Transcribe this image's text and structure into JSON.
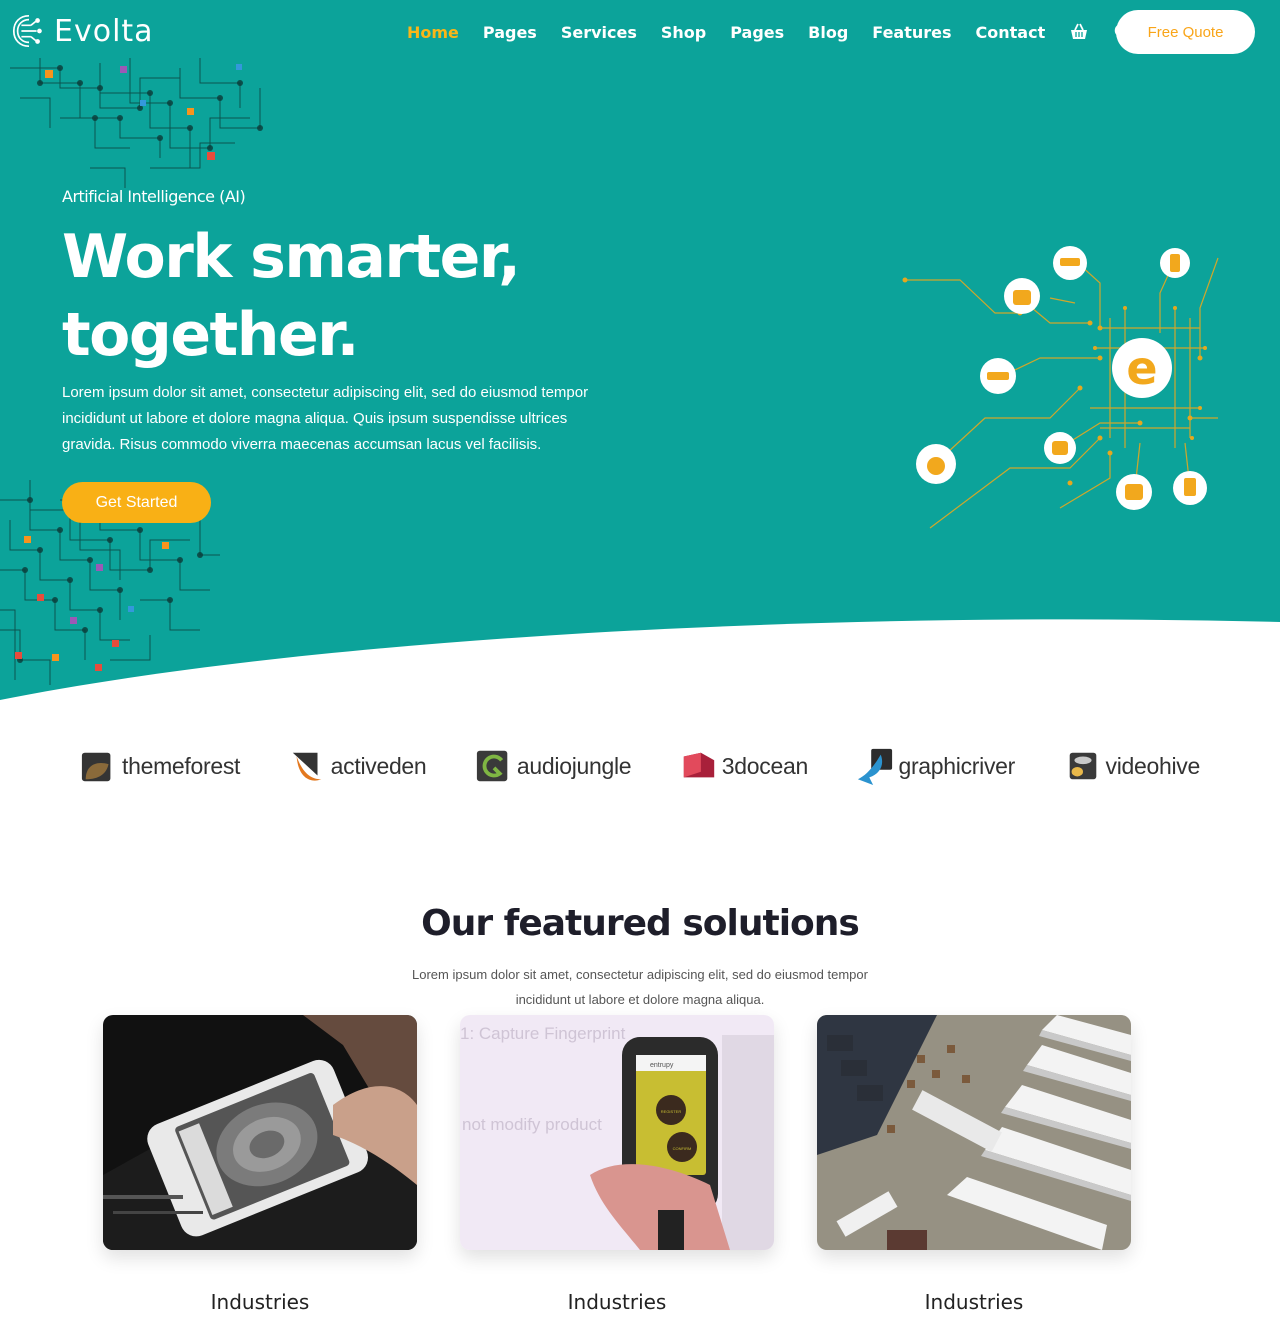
{
  "header": {
    "logo_text": "Evolta",
    "nav": [
      {
        "label": "Home",
        "active": true
      },
      {
        "label": "Pages",
        "active": false
      },
      {
        "label": "Services",
        "active": false
      },
      {
        "label": "Shop",
        "active": false
      },
      {
        "label": "Pages",
        "active": false
      },
      {
        "label": "Blog",
        "active": false
      },
      {
        "label": "Features",
        "active": false
      },
      {
        "label": "Contact",
        "active": false
      }
    ],
    "icons": [
      "basket-icon",
      "search-icon"
    ],
    "quote_label": "Free Quote"
  },
  "hero": {
    "eyebrow": "Artificial Intelligence (AI)",
    "headline_line1": "Work smarter,",
    "headline_line2": "together.",
    "description": "Lorem ipsum dolor sit amet, consectetur adipiscing elit, sed do eiusmod tempor incididunt ut labore et dolore magna aliqua. Quis ipsum suspendisse ultrices gravida. Risus commodo viverra maecenas accumsan lacus vel facilisis.",
    "cta_label": "Get Started",
    "graphic_letter": "e"
  },
  "brands": [
    {
      "name": "themeforest",
      "icon": "themeforest-icon"
    },
    {
      "name": "activeden",
      "icon": "activeden-icon"
    },
    {
      "name": "audiojungle",
      "icon": "audiojungle-icon"
    },
    {
      "name": "3docean",
      "icon": "3docean-icon"
    },
    {
      "name": "graphicriver",
      "icon": "graphicriver-icon"
    },
    {
      "name": "videohive",
      "icon": "videohive-icon"
    }
  ],
  "featured": {
    "title": "Our featured solutions",
    "description": "Lorem ipsum dolor sit amet, consectetur adipiscing elit, sed do eiusmod tempor incididunt ut labore et dolore magna aliqua.",
    "cards": [
      {
        "title": "Industries",
        "image": "fingerprint-phone-image"
      },
      {
        "title": "Industries",
        "image": "phone-app-image",
        "image_text_1": "1: Capture Fingerprint",
        "image_text_2": "not modify product",
        "screen_brand": "entrupy",
        "screen_btn_1": "REGISTER",
        "screen_btn_2": "CONFIRM"
      },
      {
        "title": "Industries",
        "image": "warehouse-aerial-image"
      }
    ]
  },
  "colors": {
    "teal": "#0ca39a",
    "orange": "#f9b015",
    "white": "#ffffff",
    "dark": "#1e1e2a"
  }
}
